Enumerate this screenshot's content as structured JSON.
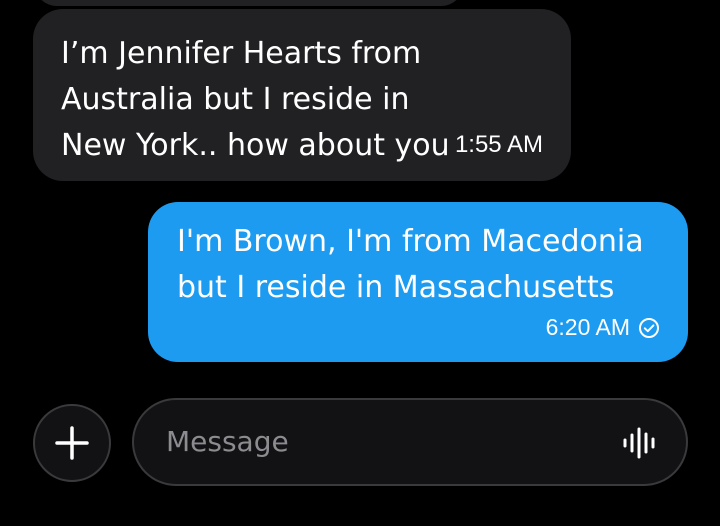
{
  "conversation": {
    "incoming": {
      "text": "I’m Jennifer Hearts from Australia but I reside in New York.. how about you",
      "time": "1:55 AM"
    },
    "outgoing": {
      "text": "I'm Brown, I'm from Macedonia but I reside in Massachusetts",
      "time": "6:20 AM",
      "status_icon": "sent-check-icon"
    }
  },
  "composer": {
    "add_icon": "plus-icon",
    "placeholder": "Message",
    "voice_icon": "voice-waveform-icon"
  },
  "colors": {
    "background": "#000000",
    "incoming_bubble": "#212124",
    "outgoing_bubble": "#1d9bf0",
    "placeholder": "#8b8b90"
  }
}
